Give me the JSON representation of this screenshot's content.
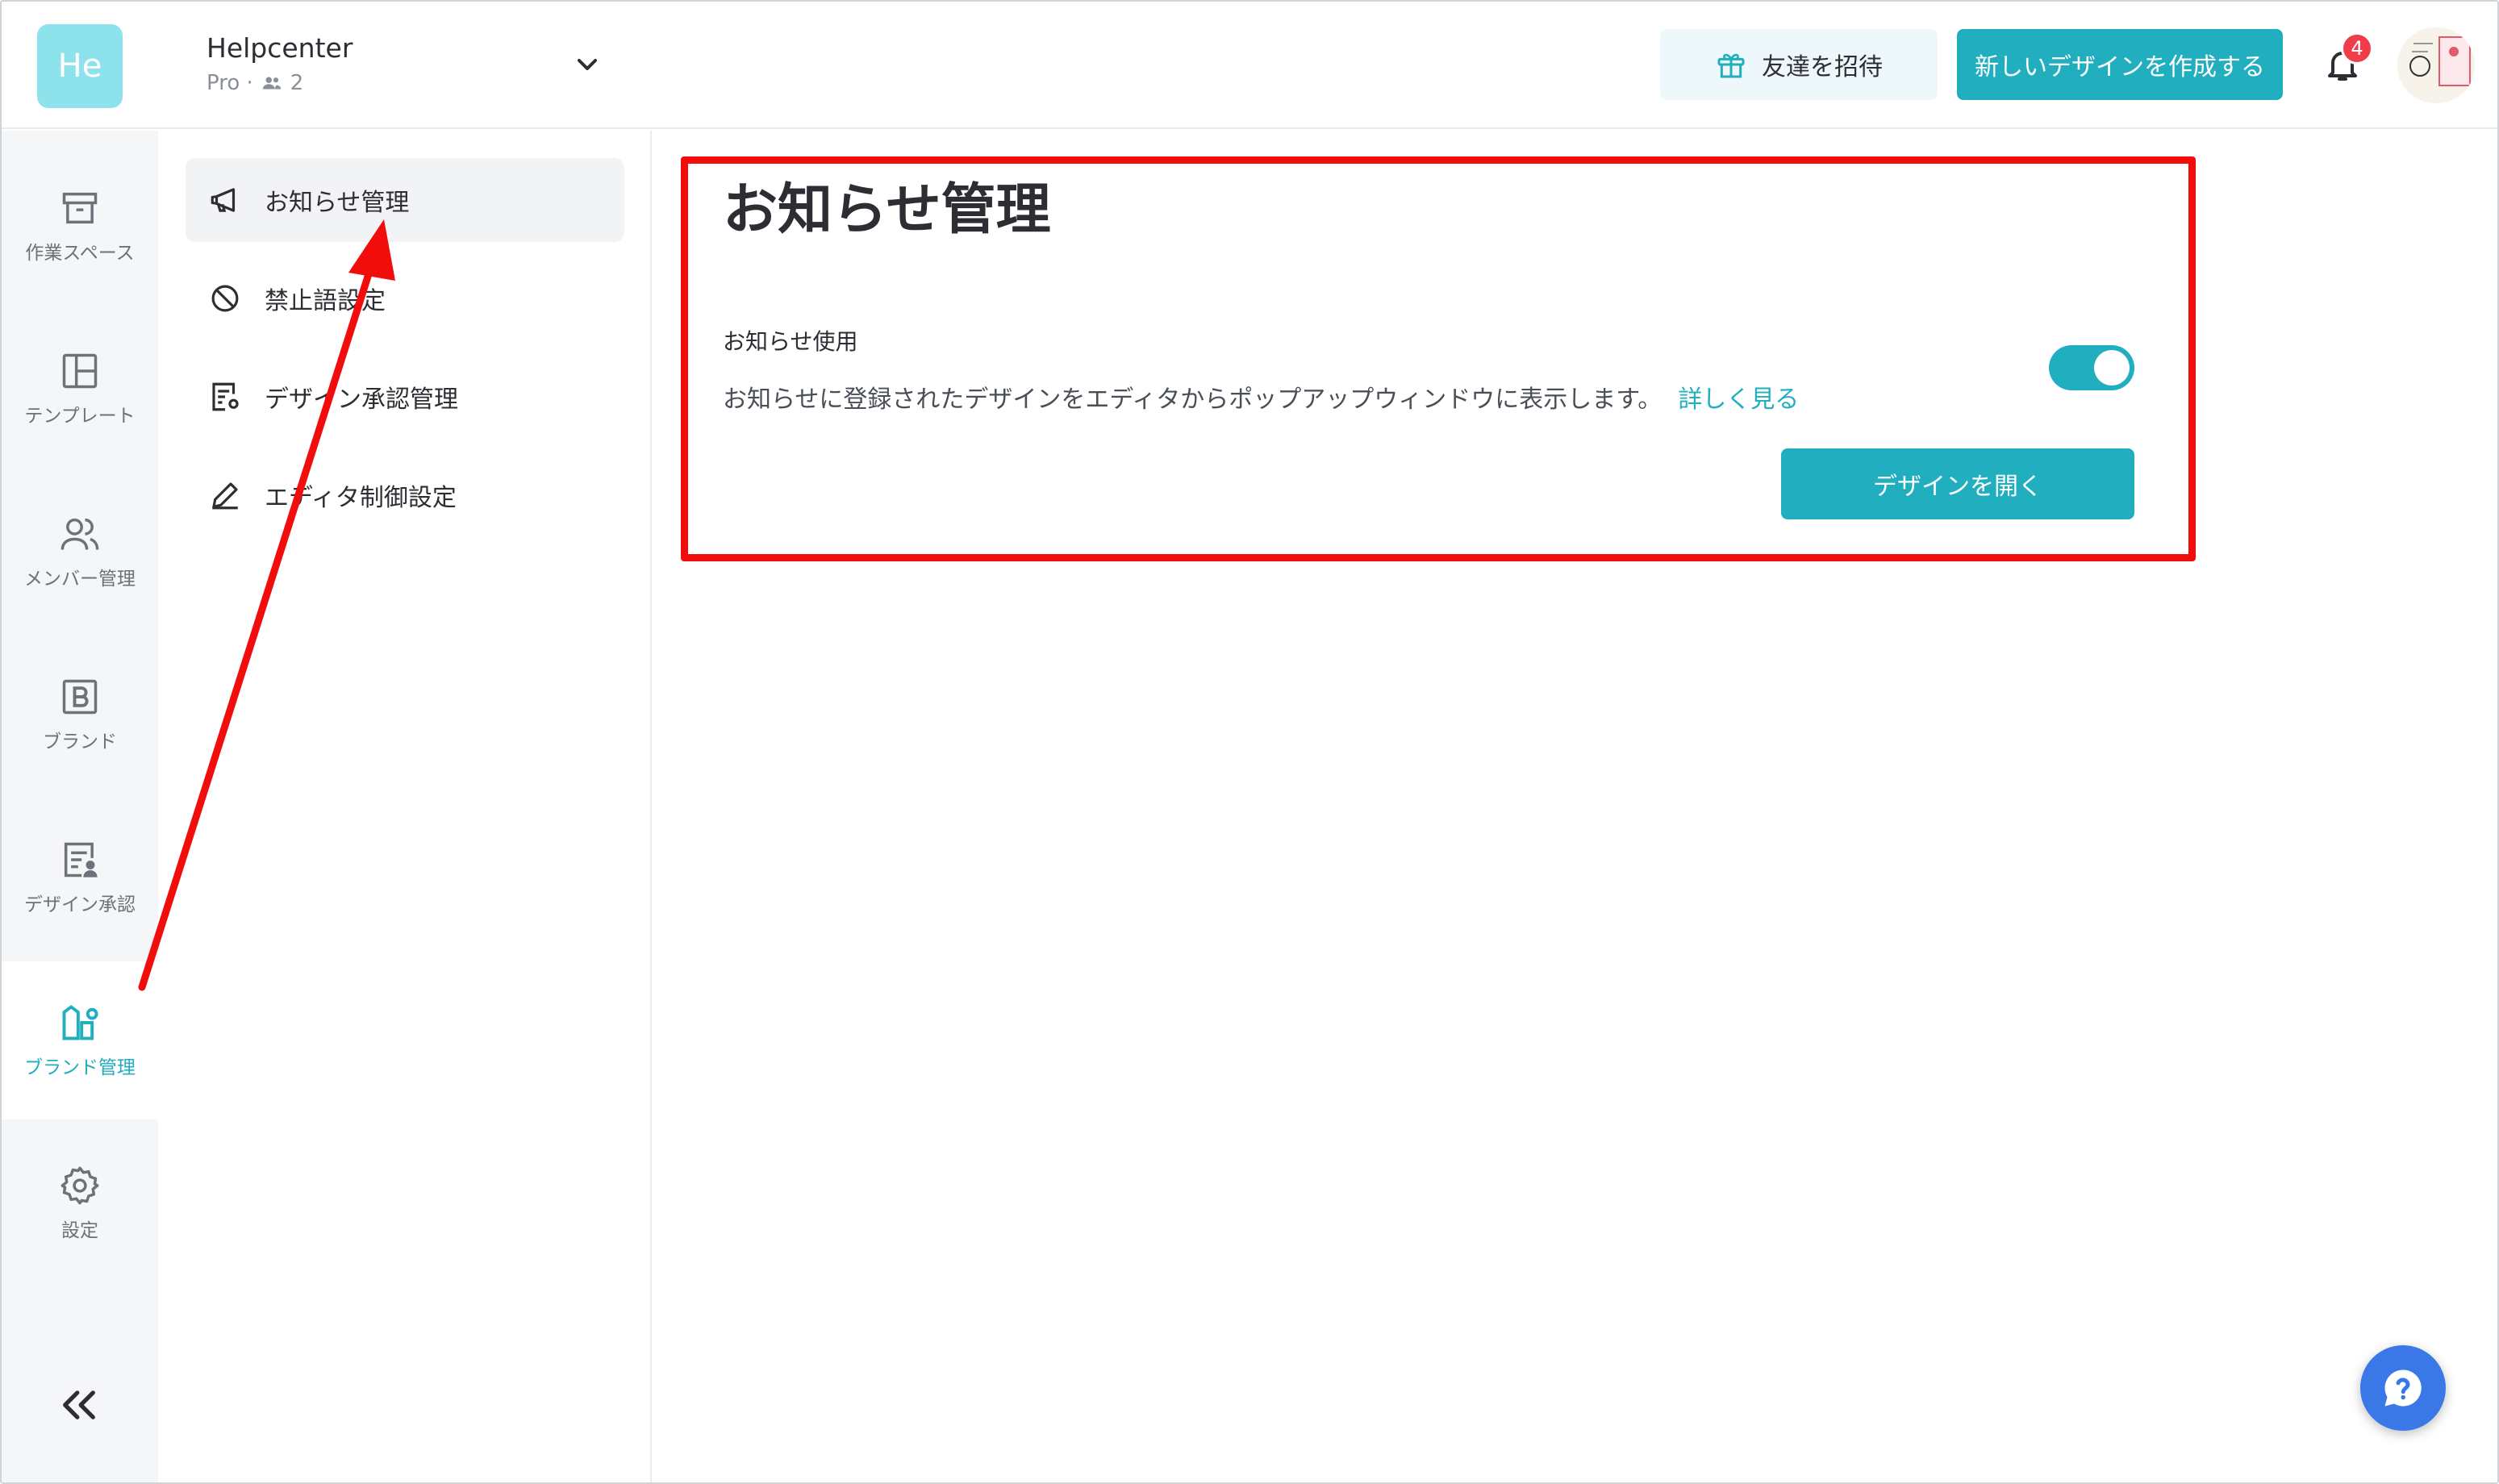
{
  "header": {
    "logo_text": "He",
    "team_name": "Helpcenter",
    "plan": "Pro ·",
    "member_count": "2",
    "invite_label": "友達を招待",
    "create_label": "新しいデザインを作成する",
    "notification_count": "4"
  },
  "rail": {
    "items": [
      {
        "label": "作業スペース",
        "icon": "archive-icon"
      },
      {
        "label": "テンプレート",
        "icon": "layout-icon"
      },
      {
        "label": "メンバー管理",
        "icon": "users-icon"
      },
      {
        "label": "ブランド",
        "icon": "brand-b-icon"
      },
      {
        "label": "デザイン承認",
        "icon": "approval-icon"
      },
      {
        "label": "ブランド管理",
        "icon": "brand-settings-icon",
        "active": true
      },
      {
        "label": "設定",
        "icon": "gear-icon"
      }
    ],
    "collapse_icon": "double-chevron-left-icon"
  },
  "subnav": {
    "items": [
      {
        "label": "お知らせ管理",
        "icon": "megaphone-icon",
        "active": true
      },
      {
        "label": "禁止語設定",
        "icon": "ban-icon"
      },
      {
        "label": "デザイン承認管理",
        "icon": "approval-settings-icon"
      },
      {
        "label": "エディタ制御設定",
        "icon": "pencil-icon"
      }
    ]
  },
  "main": {
    "title": "お知らせ管理",
    "setting_label": "お知らせ使用",
    "setting_description": "お知らせに登録されたデザインをエディタからポップアップウィンドウに表示します。",
    "learn_more": "詳しく見る",
    "toggle_on": true,
    "open_design_label": "デザインを開く"
  },
  "colors": {
    "accent": "#21aebf",
    "highlight_box": "#f20d0d",
    "badge": "#ef3e4a"
  }
}
